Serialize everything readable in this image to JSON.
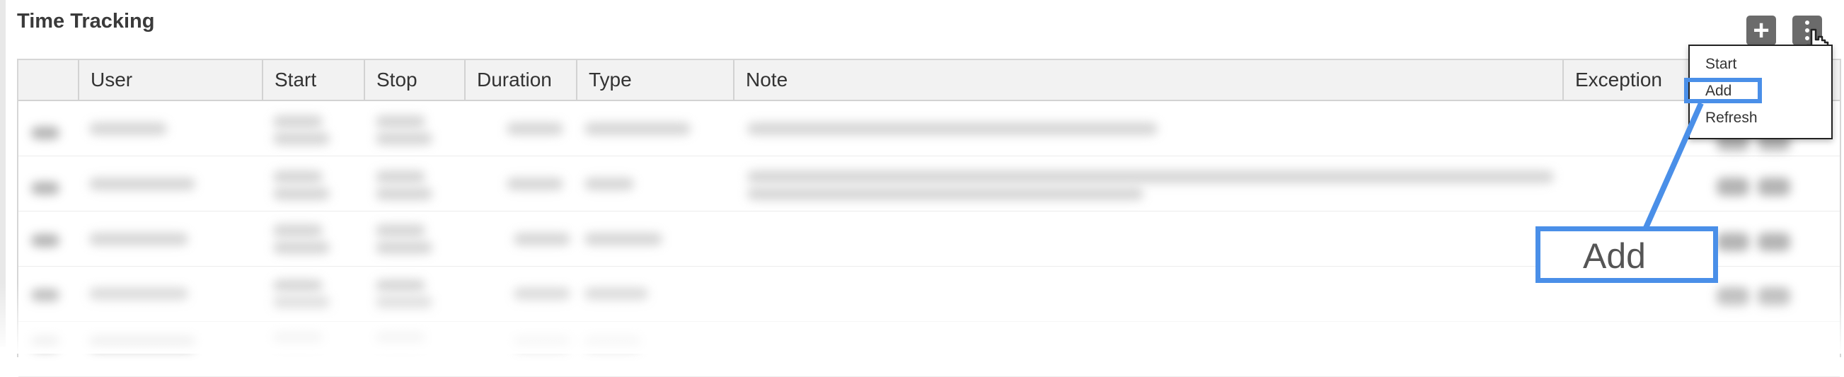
{
  "panel": {
    "title": "Time Tracking"
  },
  "toolbar": {
    "add_label": "+"
  },
  "table": {
    "columns": [
      "User",
      "Start",
      "Stop",
      "Duration",
      "Type",
      "Note",
      "Exception"
    ]
  },
  "menu": {
    "items": [
      {
        "label": "Start"
      },
      {
        "label": "Add"
      },
      {
        "label": "Refresh"
      }
    ]
  },
  "callout": {
    "label": "Add"
  },
  "colors": {
    "highlight": "#4a8fe8",
    "button": "#6b6b6b"
  }
}
